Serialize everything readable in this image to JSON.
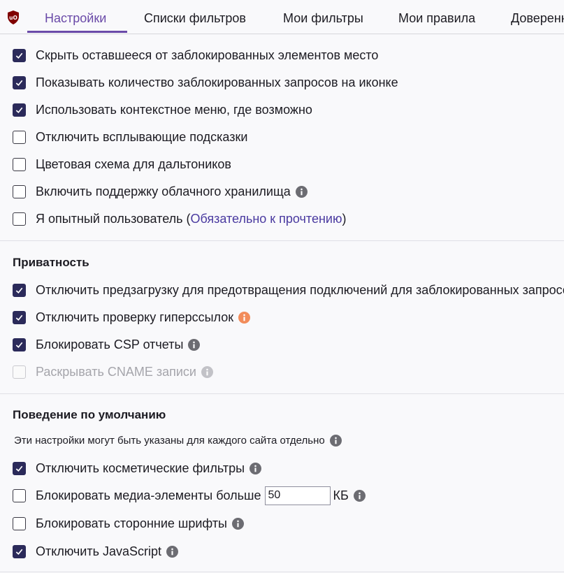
{
  "tabs": [
    {
      "label": "Настройки",
      "active": true
    },
    {
      "label": "Списки фильтров"
    },
    {
      "label": "Мои фильтры"
    },
    {
      "label": "Мои правила"
    },
    {
      "label": "Доверенные сайты"
    }
  ],
  "general": [
    {
      "label": "Скрыть оставшееся от заблокированных элементов место",
      "checked": true
    },
    {
      "label": "Показывать количество заблокированных запросов на иконке",
      "checked": true
    },
    {
      "label": "Использовать контекстное меню, где возможно",
      "checked": true
    },
    {
      "label": "Отключить всплывающие подсказки",
      "checked": false
    },
    {
      "label": "Цветовая схема для дальтоников",
      "checked": false
    },
    {
      "label": "Включить поддержку облачного хранилища",
      "checked": false,
      "info": true
    },
    {
      "label_prefix": "Я опытный пользователь (",
      "link": "Обязательно к прочтению",
      "label_suffix": ")",
      "checked": false
    }
  ],
  "privacy": {
    "title": "Приватность",
    "items": [
      {
        "label": "Отключить предзагрузку для предотвращения подключений для заблокированных запросов",
        "checked": true
      },
      {
        "label": "Отключить проверку гиперссылок",
        "checked": true,
        "info": "orange"
      },
      {
        "label": "Блокировать CSP отчеты",
        "checked": true,
        "info": true
      },
      {
        "label": "Раскрывать CNAME записи",
        "checked": false,
        "disabled": true,
        "info": true
      }
    ]
  },
  "defaults": {
    "title": "Поведение по умолчанию",
    "hint": "Эти настройки могут быть указаны для каждого сайта отдельно",
    "items": [
      {
        "label": "Отключить косметические фильтры",
        "checked": true
      },
      {
        "label": "Блокировать медиа-элементы больше",
        "checked": false,
        "input_value": "50",
        "unit": "КБ"
      },
      {
        "label": "Блокировать сторонние шрифты",
        "checked": false
      },
      {
        "label": "Отключить JavaScript",
        "checked": true
      }
    ]
  },
  "colors": {
    "accent": "#6a4aa8",
    "checkbox_checked": "#2b2a5a",
    "info_orange": "#f28c5a",
    "info_gray": "#6c6c72"
  },
  "icons": {
    "logo": "ublock-origin-shield-icon",
    "info": "info-icon",
    "check": "check-icon"
  }
}
